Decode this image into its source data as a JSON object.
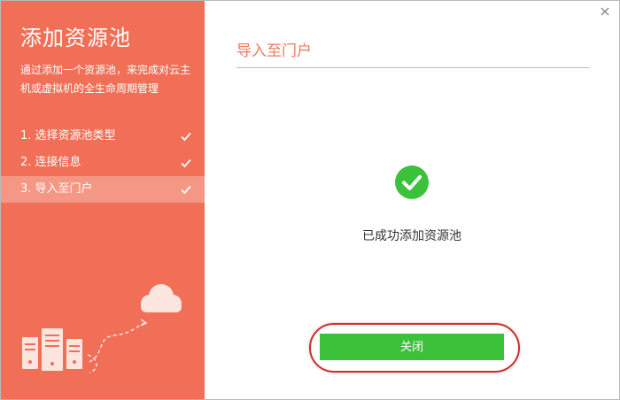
{
  "sidebar": {
    "title": "添加资源池",
    "description": "通过添加一个资源池，来完成对云主机或虚拟机的全生命周期管理",
    "steps": [
      {
        "label": "1. 选择资源池类型",
        "completed": true
      },
      {
        "label": "2. 连接信息",
        "completed": true
      },
      {
        "label": "3. 导入至门户",
        "completed": true,
        "active": true
      }
    ],
    "accent_color": "#f06f56"
  },
  "main": {
    "title": "导入至门户",
    "success_icon": "check-circle-icon",
    "success_message": "已成功添加资源池",
    "close_button_label": "关闭",
    "close_icon": "close-icon",
    "button_color": "#3cc13b"
  }
}
